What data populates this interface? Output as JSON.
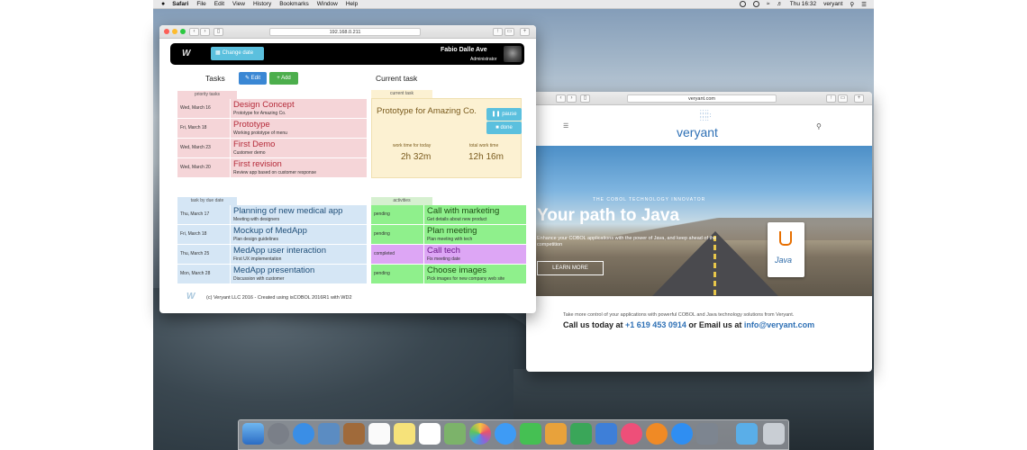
{
  "menubar": {
    "app": "Safari",
    "items": [
      "File",
      "Edit",
      "View",
      "History",
      "Bookmarks",
      "Window",
      "Help"
    ],
    "clock": "Thu 16:32",
    "user": "veryant"
  },
  "window1": {
    "url": "192.168.0.211",
    "header": {
      "change_date": "Change date",
      "user_name": "Fabio Dalle Ave",
      "user_role": "Administrator"
    },
    "tasks_title": "Tasks",
    "edit_label": "Edit",
    "add_label": "Add",
    "current_title": "Current task",
    "priority_label": "priority tasks",
    "priority": [
      {
        "date": "Wed, March 16",
        "title": "Design Concept",
        "sub": "Prototype for Amazing Co."
      },
      {
        "date": "Fri, March 18",
        "title": "Prototype",
        "sub": "Working prototype of menu"
      },
      {
        "date": "Wed, March 23",
        "title": "First Demo",
        "sub": "Customer demo"
      },
      {
        "date": "Wed, March 20",
        "title": "First revision",
        "sub": "Review app based on customer response"
      }
    ],
    "current_label": "current task",
    "current": {
      "title": "Prototype for Amazing Co.",
      "pause": "pause",
      "done": "done",
      "work_today_label": "work time for today",
      "work_today": "2h 32m",
      "total_label": "total work time",
      "total": "12h 16m"
    },
    "due_label": "task by due date",
    "due": [
      {
        "date": "Thu, March 17",
        "title": "Planning of new medical app",
        "sub": "Meeting with designers"
      },
      {
        "date": "Fri, March 18",
        "title": "Mockup of MedApp",
        "sub": "Plan design guidelines"
      },
      {
        "date": "Thu, March 25",
        "title": "MedApp user interaction",
        "sub": "First UX implementation"
      },
      {
        "date": "Mon, March 28",
        "title": "MedApp presentation",
        "sub": "Discussion with customer"
      }
    ],
    "activities_label": "activities",
    "activities": [
      {
        "status": "pending",
        "title": "Call with marketing",
        "sub": "Get details about new product"
      },
      {
        "status": "pending",
        "title": "Plan meeting",
        "sub": "Plan meeting with tech"
      },
      {
        "status": "completed",
        "title": "Call tech",
        "sub": "Fix meeting date"
      },
      {
        "status": "pending",
        "title": "Choose images",
        "sub": "Pick images for new company web site"
      }
    ],
    "footer": "(c) Veryant LLC 2016 - Created using isCOBOL 2016R1 with WD2"
  },
  "window2": {
    "url": "veryant.com",
    "logo": "veryant",
    "tagline": "THE COBOL TECHNOLOGY INNOVATOR",
    "hero_title": "Your path to Java",
    "hero_sub": "Enhance your COBOL applications with the power of Java, and keep ahead of the competition",
    "learn_more": "LEARN MORE",
    "java_label": "Java",
    "line1": "Take more control of your applications with powerful COBOL and Java technology solutions from Veryant.",
    "line2a": "Call us today at ",
    "phone": "+1 619 453 0914",
    "line2b": " or Email us at ",
    "email": "info@veryant.com"
  },
  "colors": {
    "priority_bg": "#f5d5d8",
    "priority_text": "#b52b3a",
    "due_bg": "#d5e6f5",
    "due_text": "#1f4e78",
    "activity_green": "#8ff08c",
    "activity_purple": "#dda6f5",
    "current_bg": "#fcf1d2",
    "accent": "#5bc0de"
  }
}
